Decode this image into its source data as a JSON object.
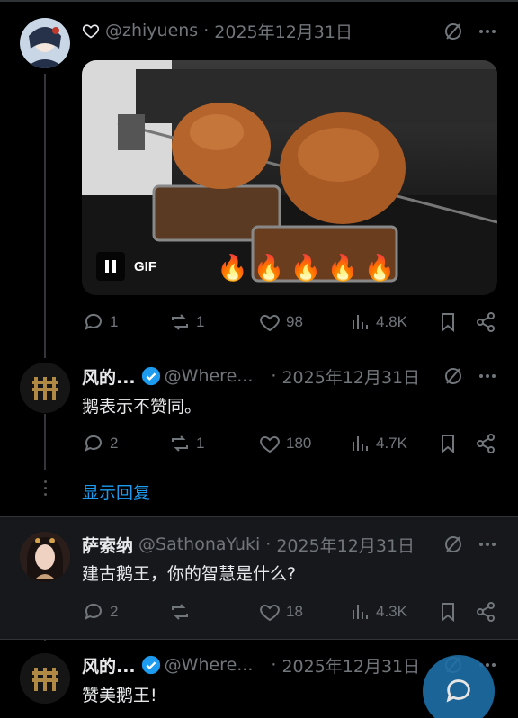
{
  "colors": {
    "background": "#000000",
    "text": "#e7e9ea",
    "muted": "#71767b",
    "accent": "#1d9bf0",
    "verified": "#1d9bf0"
  },
  "tweets": [
    {
      "handle": "@zhiyuens",
      "separator": "·",
      "date": "2025年12月31日",
      "icons": [
        "heart-outline-icon",
        "grok-icon",
        "more-icon"
      ],
      "media": {
        "type": "gif",
        "label": "GIF",
        "fires": "🔥🔥🔥🔥🔥"
      },
      "stats": {
        "replies": "1",
        "reposts": "1",
        "likes": "98",
        "views": "4.8K"
      }
    },
    {
      "name": "风的...",
      "handle": "@Where...",
      "separator": "·",
      "date": "2025年12月31日",
      "text": "鹅表示不赞同。",
      "stats": {
        "replies": "2",
        "reposts": "1",
        "likes": "180",
        "views": "4.7K"
      }
    },
    {
      "name": "萨索纳",
      "handle": "@SathonaYuki",
      "separator": "·",
      "date": "2025年12月31日",
      "text": "建古鹅王，你的智慧是什么?",
      "stats": {
        "replies": "2",
        "reposts": "",
        "likes": "18",
        "views": "4.3K"
      }
    },
    {
      "name": "风的...",
      "handle": "@Where...",
      "separator": "·",
      "date": "2025年12月31日",
      "text": "赞美鹅王!"
    }
  ],
  "show_replies": "显示回复"
}
